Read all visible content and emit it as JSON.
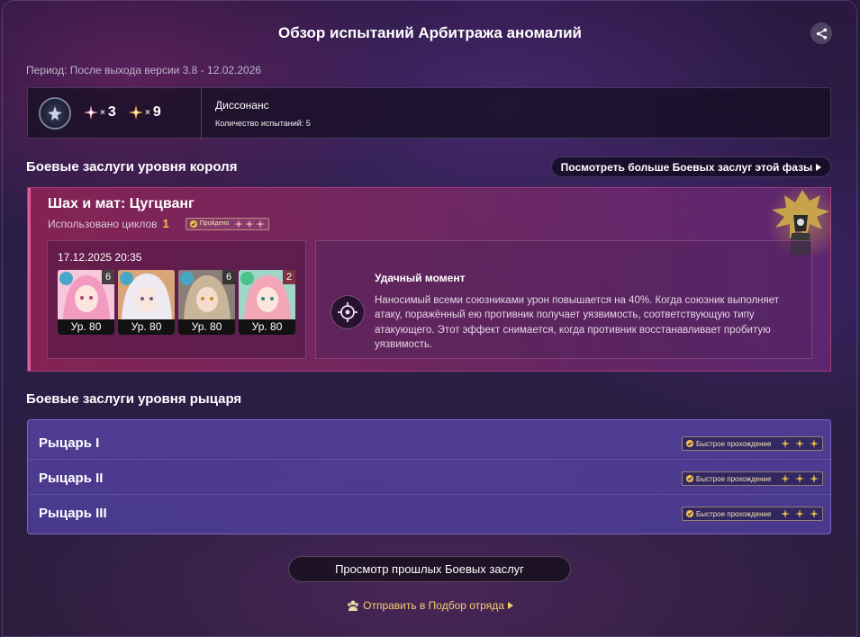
{
  "header": {
    "title": "Обзор испытаний Арбитража аномалий"
  },
  "period": "Период: После выхода версии 3.8 - 12.02.2026",
  "info": {
    "stat1": {
      "mult": "×",
      "value": "3"
    },
    "stat2": {
      "mult": "×",
      "value": "9"
    },
    "name": "Диссонанс",
    "count": "Количество испытаний: 5"
  },
  "king": {
    "section_title": "Боевые заслуги уровня короля",
    "more_button": "Посмотреть больше Боевых заслуг этой фазы",
    "title": "Шах и мат: Цугцванг",
    "cycles_label": "Использовано циклов",
    "cycles_value": "1",
    "passed_badge": "Пройдено",
    "date": "17.12.2025 20:35",
    "team": [
      {
        "level": "Ур. 80",
        "eidolon": "6"
      },
      {
        "level": "Ур. 80",
        "eidolon": ""
      },
      {
        "level": "Ур. 80",
        "eidolon": "6"
      },
      {
        "level": "Ур. 80",
        "eidolon": "2"
      }
    ],
    "buff_title": "Удачный момент",
    "buff_desc": "Наносимый всеми союзниками урон повышается на 40%. Когда союзник выполняет атаку, поражённый ею противник получает уязвимость, соответствующую типу атакующего. Этот эффект снимается, когда противник восстанавливает пробитую уязвимость."
  },
  "knight": {
    "section_title": "Боевые заслуги уровня рыцаря",
    "rows": [
      {
        "name": "Рыцарь I",
        "badge": "Быстрое прохождение"
      },
      {
        "name": "Рыцарь II",
        "badge": "Быстрое прохождение"
      },
      {
        "name": "Рыцарь III",
        "badge": "Быстрое прохождение"
      }
    ]
  },
  "footer": {
    "past_button": "Просмотр прошлых Боевых заслуг",
    "send_link": "Отправить в Подбор отряда"
  },
  "colors": {
    "accent_gold": "#f2c34a",
    "king_border": "#e05a9a",
    "knight_bg": "#5a46aa"
  },
  "icons": [
    "share-icon",
    "dissonance-icon",
    "star-pink-icon",
    "star-gold-icon",
    "chevron-right-icon",
    "check-icon",
    "crosshair-icon",
    "squad-icon"
  ]
}
